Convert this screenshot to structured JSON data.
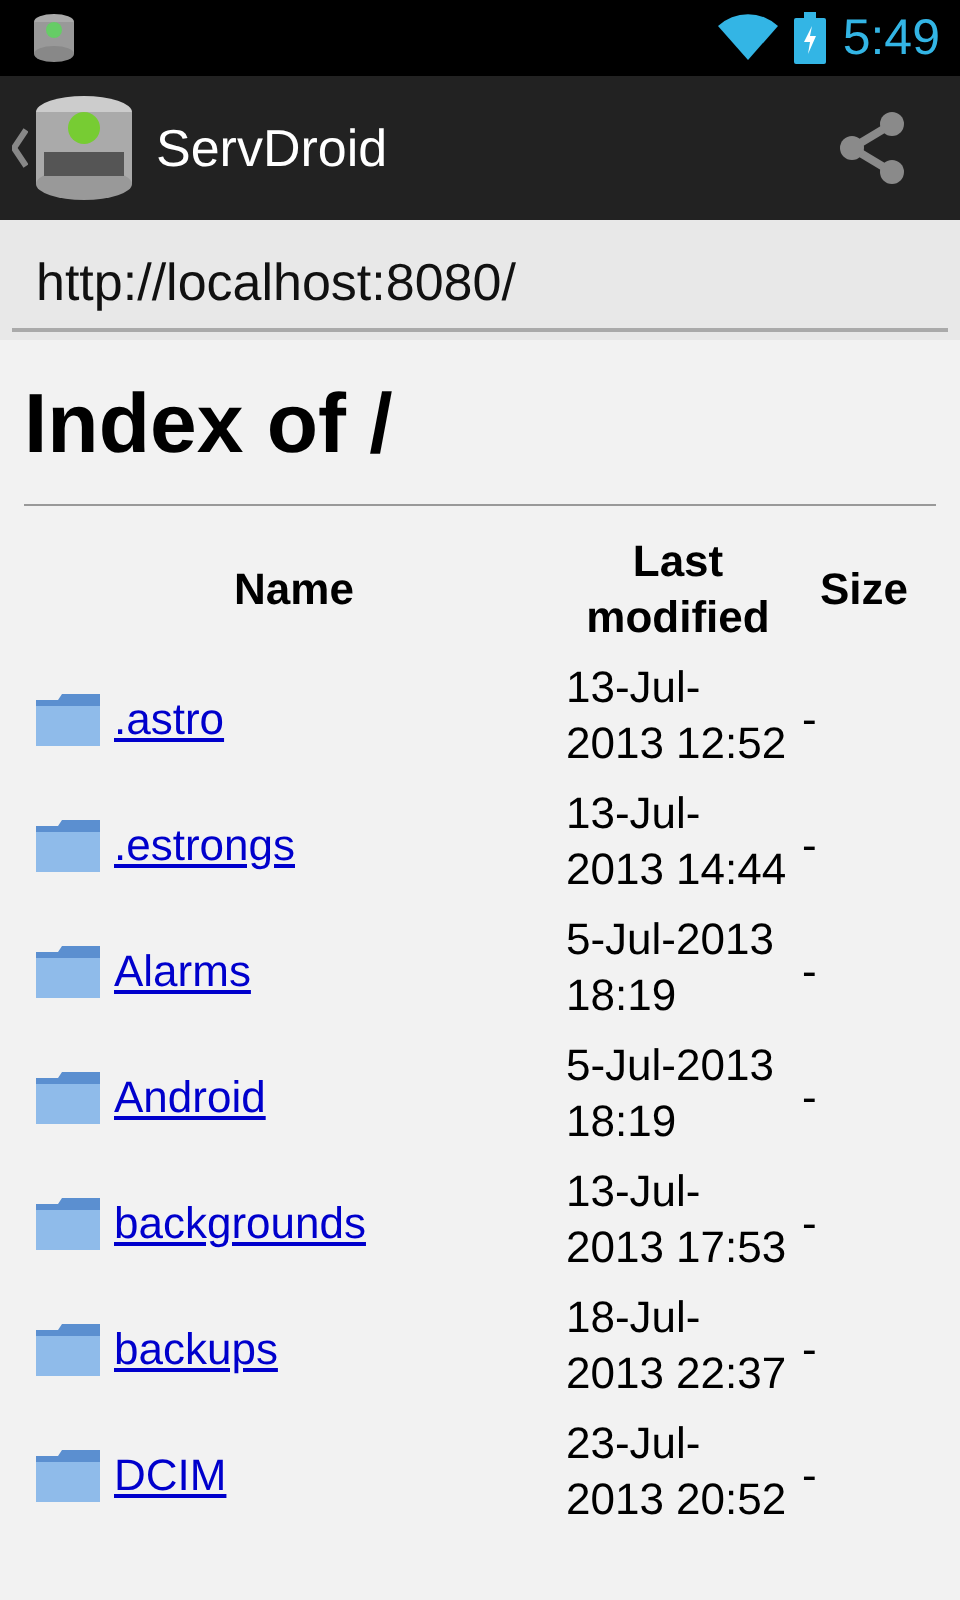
{
  "status_bar": {
    "time": "5:49"
  },
  "action_bar": {
    "title": "ServDroid"
  },
  "address_field": {
    "value": "http://localhost:8080/"
  },
  "page": {
    "heading": "Index of /",
    "table": {
      "columns": [
        "Name",
        "Last modified",
        "Size"
      ],
      "rows": [
        {
          "name": ".astro",
          "modified": "13-Jul-2013 12:52",
          "size": "-"
        },
        {
          "name": ".estrongs",
          "modified": "13-Jul-2013 14:44",
          "size": "-"
        },
        {
          "name": "Alarms",
          "modified": "5-Jul-2013 18:19",
          "size": "-"
        },
        {
          "name": "Android",
          "modified": "5-Jul-2013 18:19",
          "size": "-"
        },
        {
          "name": "backgrounds",
          "modified": "13-Jul-2013 17:53",
          "size": "-"
        },
        {
          "name": "backups",
          "modified": "18-Jul-2013 22:37",
          "size": "-"
        },
        {
          "name": "DCIM",
          "modified": "23-Jul-2013 20:52",
          "size": "-"
        }
      ]
    }
  }
}
